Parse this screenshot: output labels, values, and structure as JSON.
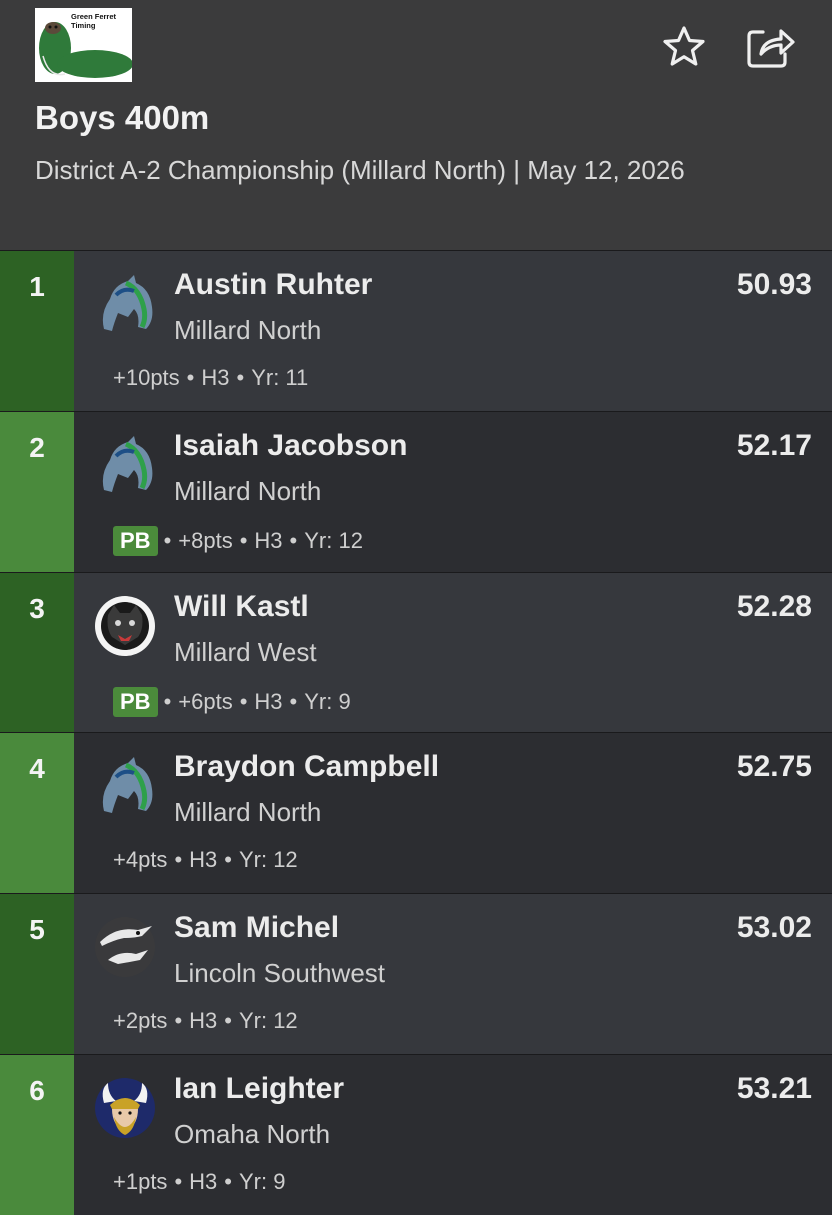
{
  "header": {
    "logo_text": "Green Ferret Timing",
    "title": "Boys 400m",
    "subtitle": "District A-2 Championship (Millard North) | May 12, 2026",
    "favorite_icon": "star-icon",
    "share_icon": "share-icon"
  },
  "colors": {
    "header_bg": "#3b3b3c",
    "row_bg_first": "#36383d",
    "row_bg": "#2c2d31",
    "place_dark": "#2d6224",
    "place_light": "#4a8a3c",
    "pb_badge": "#4b8b3b"
  },
  "results": [
    {
      "place": "1",
      "name": "Austin Ruhter",
      "team": "Millard North",
      "time": "50.93",
      "pb": "",
      "points": "+10pts",
      "heat": "H3",
      "year": "Yr: 11",
      "logo": "mustang-logo"
    },
    {
      "place": "2",
      "name": "Isaiah Jacobson",
      "team": "Millard North",
      "time": "52.17",
      "pb": "PB",
      "points": "+8pts",
      "heat": "H3",
      "year": "Yr: 12",
      "logo": "mustang-logo"
    },
    {
      "place": "3",
      "name": "Will Kastl",
      "team": "Millard West",
      "time": "52.28",
      "pb": "PB",
      "points": "+6pts",
      "heat": "H3",
      "year": "Yr: 9",
      "logo": "wildcat-logo"
    },
    {
      "place": "4",
      "name": "Braydon Campbell",
      "team": "Millard North",
      "time": "52.75",
      "pb": "",
      "points": "+4pts",
      "heat": "H3",
      "year": "Yr: 12",
      "logo": "mustang-logo"
    },
    {
      "place": "5",
      "name": "Sam Michel",
      "team": "Lincoln Southwest",
      "time": "53.02",
      "pb": "",
      "points": "+2pts",
      "heat": "H3",
      "year": "Yr: 12",
      "logo": "hawk-logo"
    },
    {
      "place": "6",
      "name": "Ian Leighter",
      "team": "Omaha North",
      "time": "53.21",
      "pb": "",
      "points": "+1pts",
      "heat": "H3",
      "year": "Yr: 9",
      "logo": "viking-logo"
    }
  ]
}
